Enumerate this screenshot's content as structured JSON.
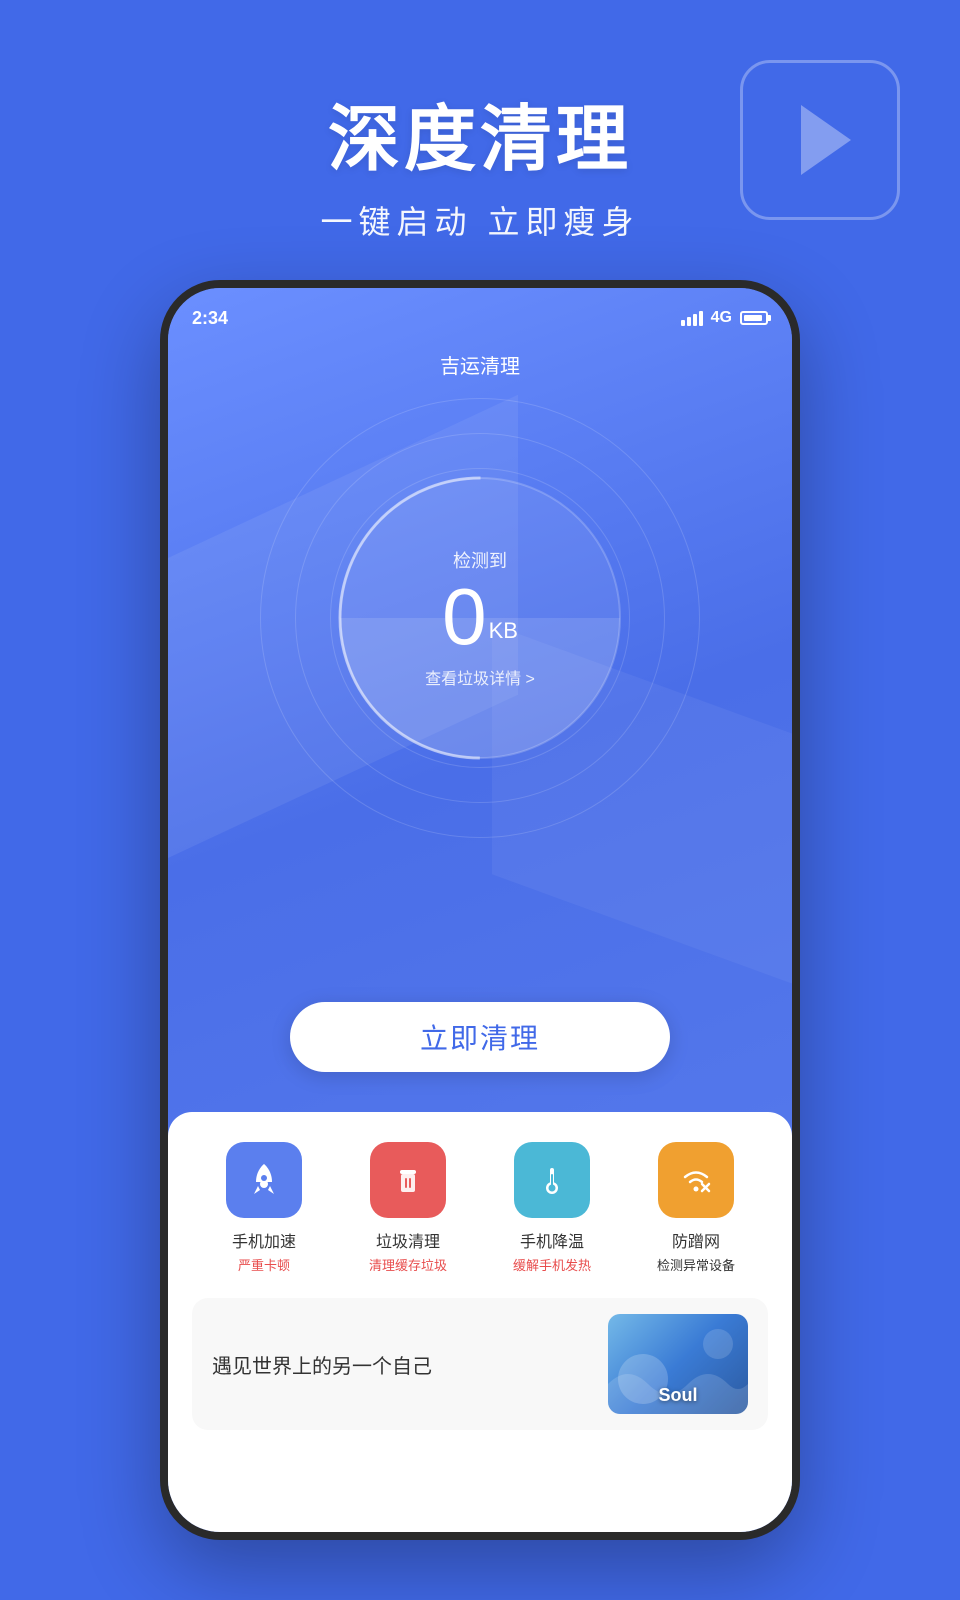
{
  "background_color": "#4169e8",
  "hero": {
    "title": "深度清理",
    "subtitle": "一键启动 立即瘦身"
  },
  "phone": {
    "status_bar": {
      "time": "2:34",
      "signal": "4G"
    },
    "app_title": "吉运清理",
    "gauge": {
      "label": "检测到",
      "value": "0",
      "unit": "KB",
      "link": "查看垃圾详情 >"
    },
    "clean_button": "立即清理",
    "app_icons": [
      {
        "name": "手机加速",
        "desc": "严重卡顿",
        "desc_color": "#e84d4d",
        "bg_color": "#5b7fee",
        "icon": "🚀"
      },
      {
        "name": "垃圾清理",
        "desc": "清理缓存垃圾",
        "desc_color": "#e84d4d",
        "bg_color": "#e85b5b",
        "icon": "🗑"
      },
      {
        "name": "手机降温",
        "desc": "缓解手机发热",
        "desc_color": "#e84d4d",
        "bg_color": "#4bb8d6",
        "icon": "🌡"
      },
      {
        "name": "防蹭网",
        "desc": "检测异常设备",
        "desc_color": "#333",
        "bg_color": "#f0a030",
        "icon": "📶"
      }
    ],
    "banner": {
      "text": "遇见世界上的另一个自己",
      "image_label": "Soul"
    }
  }
}
